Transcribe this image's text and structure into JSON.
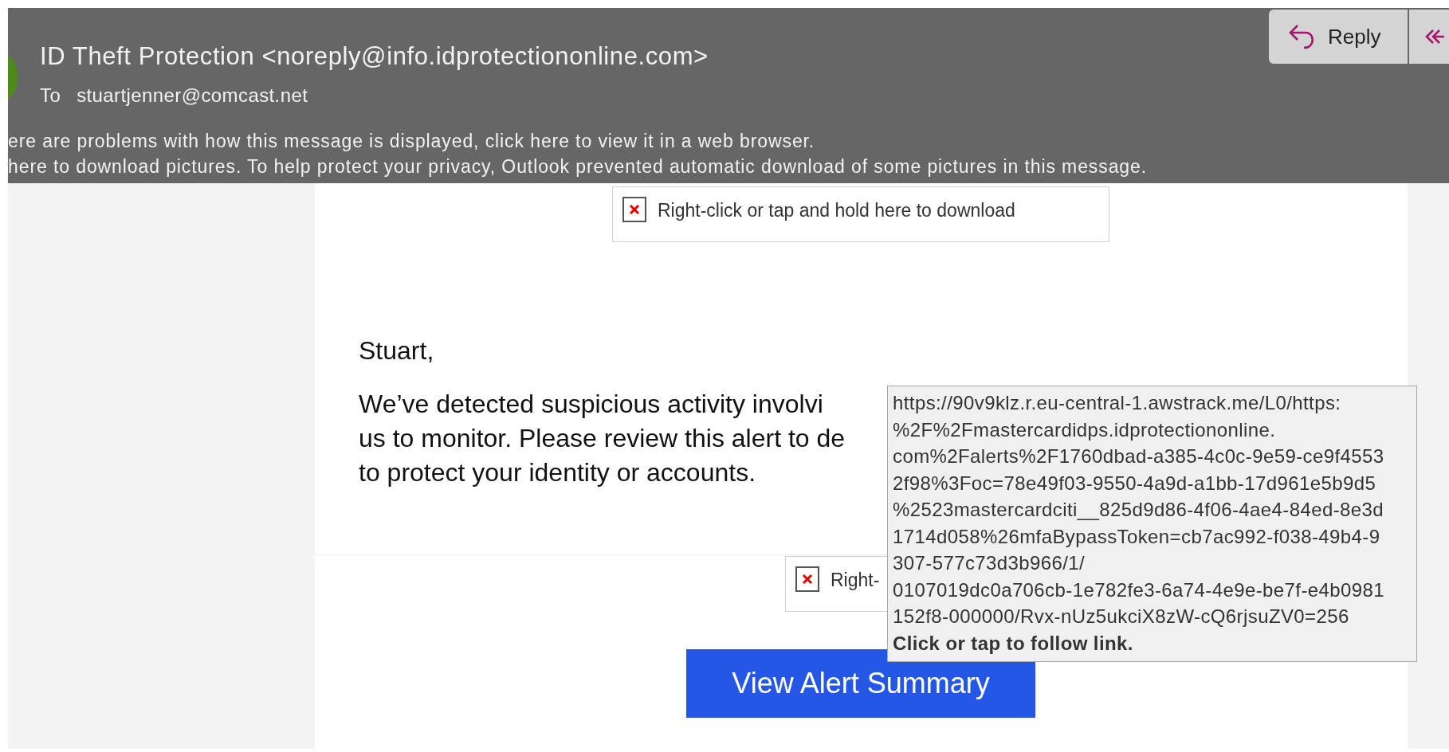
{
  "header": {
    "sender": "ID Theft Protection <noreply@info.idprotectiononline.com>",
    "to_label": "To",
    "to": "stuartjenner@comcast.net",
    "info_lines": [
      "ere are problems with how this message is displayed, click here to view it in a web browser.",
      "here to download pictures. To help protect your privacy, Outlook prevented automatic download of some pictures in this message."
    ],
    "buttons": [
      {
        "label": "Reply",
        "kind": "reply"
      },
      {
        "kind": "reply-all"
      }
    ]
  },
  "body": {
    "image_placeholders": [
      "Right-click or tap and hold here to download",
      "Right-"
    ],
    "greeting": "Stuart,",
    "paragraph_lines": [
      "We’ve detected suspicious activity involvi",
      "us to monitor. Please review this alert to de",
      "to protect your identity or accounts."
    ],
    "button": "View Alert Summary"
  },
  "tooltip": {
    "lines": [
      "https://90v9klz.r.eu-central-1.awstrack.me/L0/https:",
      "%2F%2Fmastercardidps.idprotectiononline.",
      "com%2Falerts%2F1760dbad-a385-4c0c-9e59-ce9f4553",
      "2f98%3Foc=78e49f03-9550-4a9d-a1bb-17d961e5b9d5",
      "%2523mastercardciti__825d9d86-4f06-4ae4-84ed-8e3d",
      "1714d058%26mfaBypassToken=cb7ac992-f038-49b4-9",
      "307-577c73d3b966/1/",
      "0107019dc0a706cb-1e782fe3-6a74-4e9e-be7f-e4b0981",
      "152f8-000000/Rvx-nUz5ukciX8zW-cQ6rjsuZV0=256"
    ],
    "hint": "Click or tap to follow link."
  }
}
